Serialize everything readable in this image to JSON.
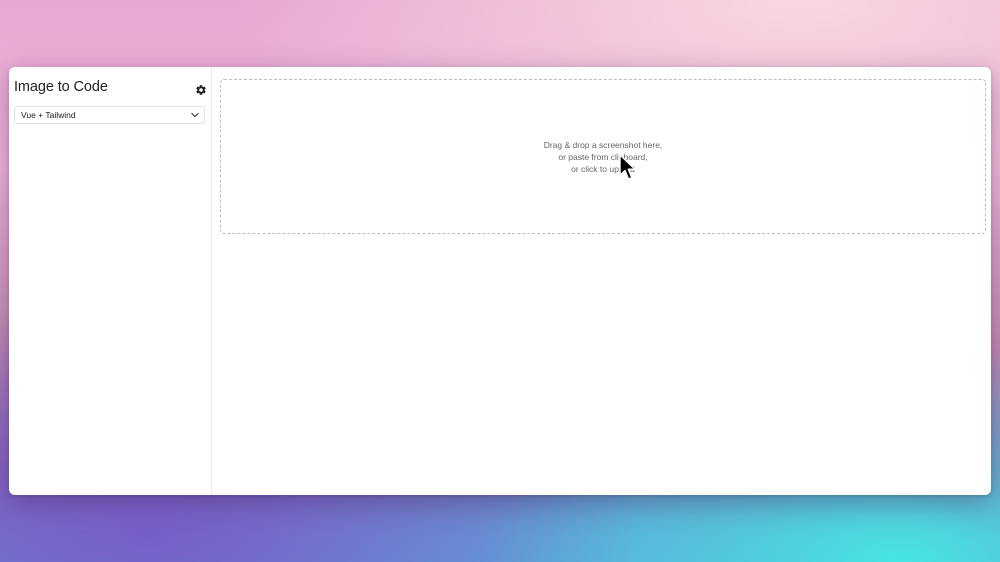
{
  "app": {
    "title": "Image to Code"
  },
  "settings": {
    "icon": "gear-icon"
  },
  "framework_select": {
    "selected": "Vue + Tailwind",
    "icon": "chevron-down-icon"
  },
  "dropzone": {
    "line1": "Drag & drop a screenshot here,",
    "line2": "or paste from clipboard,",
    "line3": "or click to upload"
  },
  "colors": {
    "window_bg": "#ffffff",
    "border": "#bdbdbd",
    "text_muted": "#666666"
  }
}
